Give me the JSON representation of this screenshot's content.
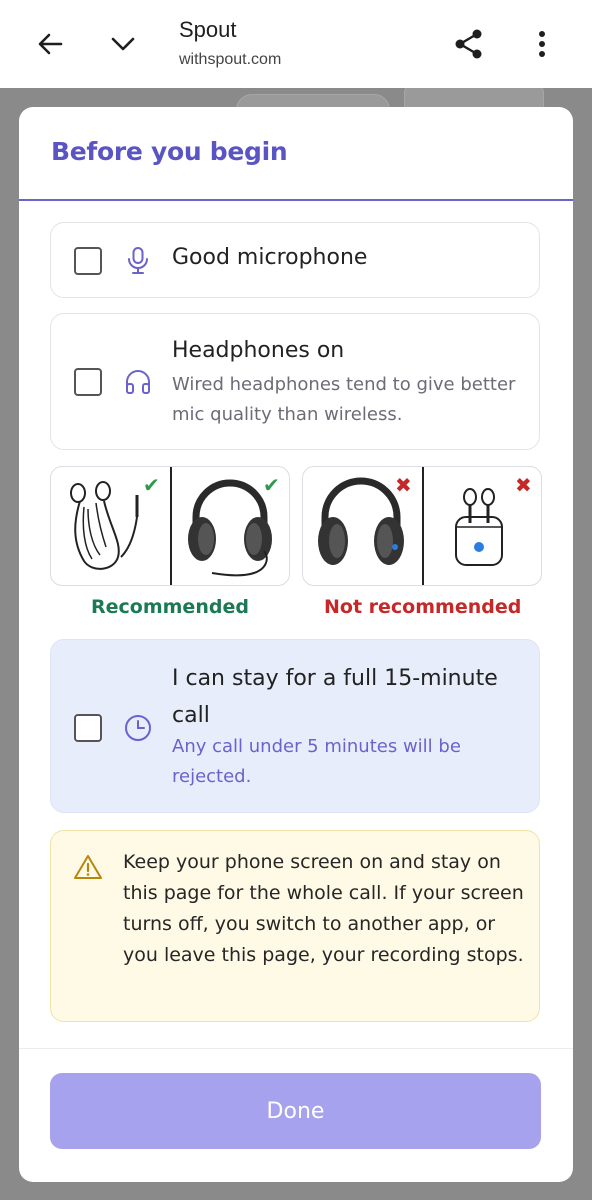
{
  "browser": {
    "title": "Spout",
    "url": "withspout.com",
    "icons": [
      "back-arrow-icon",
      "chevron-down-icon",
      "share-icon",
      "more-vert-icon"
    ]
  },
  "modal": {
    "title": "Before you begin",
    "items": [
      {
        "heading": "Good microphone",
        "icon": "microphone-icon",
        "checked": false
      },
      {
        "heading": "Headphones on",
        "subtext": "Wired headphones tend to give better mic quality than wireless.",
        "icon": "headphones-icon",
        "checked": false
      }
    ],
    "images": {
      "recommended_label": "Recommended",
      "not_recommended_label": "Not recommended",
      "recommended": [
        "wired-earbuds-image",
        "wired-headphones-image"
      ],
      "not_recommended": [
        "wireless-headphones-image",
        "wireless-earbuds-image"
      ]
    },
    "call_item": {
      "heading": "I can stay for a full 15-minute call",
      "subtext": "Any call under 5 minutes will be rejected.",
      "icon": "clock-icon",
      "checked": false
    },
    "warning": {
      "icon": "warning-triangle-icon",
      "text": "Keep your phone screen on and stay on this page for the whole call. If your screen turns off, you switch to another app, or you leave this page, your recording stops."
    },
    "done_label": "Done"
  },
  "colors": {
    "accent": "#5b55c4",
    "button": "#a7a2ee",
    "recommended": "#1b7a55",
    "not_recommended": "#c62828",
    "call_card_bg": "#e8edfb",
    "warning_bg": "#fefae6"
  }
}
